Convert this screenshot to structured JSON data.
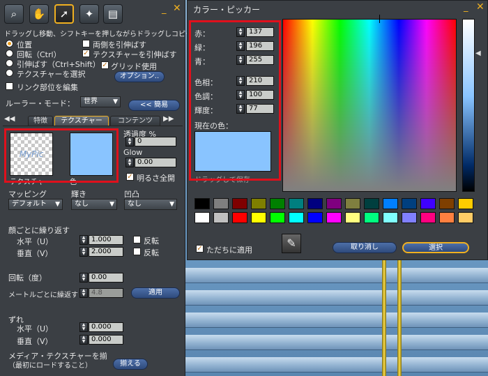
{
  "build": {
    "tool_icons": [
      "zoom-icon",
      "grab-hand-icon",
      "select-arrow-icon",
      "wand-icon",
      "land-icon"
    ],
    "hint": "ドラッグし移動、シフトキーを押しながらドラッグしコピー",
    "options": {
      "position": "位置",
      "rotate": "回転（Ctrl）",
      "stretch": "引伸ばす（Ctrl+Shift）",
      "select_texture": "テクスチャーを選択",
      "stretch_both": "両側を引伸ばす",
      "stretch_texture": "テクスチャーを引伸ばす",
      "grid": "グリッド使用",
      "options_button": "オプション..",
      "edit_linked": "リンク部位を編集"
    },
    "ruler_label": "ルーラー・モード：",
    "ruler_value": "世界",
    "simple_button": "<< 簡易",
    "tabs": [
      "特徴",
      "テクスチャー",
      "コンテンツ"
    ],
    "texture_label": "テクスチャ",
    "texture_preview_text": "MyPic",
    "color_label": "色",
    "transparency_label": "透過度 %",
    "transparency_value": "0",
    "glow_label": "Glow",
    "glow_value": "0.00",
    "full_bright_label": "明るさ全開",
    "mapping_label": "マッピング",
    "mapping_value": "デフォルト",
    "shininess_label": "輝き",
    "shininess_value": "なし",
    "bumpiness_label": "凹凸",
    "bumpiness_value": "なし",
    "repeats_per_face": "顔ごとに繰り返す",
    "horizontal_u": "水平（U）",
    "horizontal_u_value": "1.000",
    "vertical_v": "垂直（V）",
    "vertical_v_value": "2.000",
    "flip": "反転",
    "rotation_label": "回転（度）",
    "rotation_value": "0.00",
    "repeats_per_meter": "メートルごとに繰返す",
    "repeats_per_meter_value": "4.8",
    "apply_button": "適用",
    "offset_label": "ずれ",
    "offset_u": "水平（U）",
    "offset_u_value": "0.000",
    "offset_v": "垂直（V）",
    "offset_v_value": "0.000",
    "media_align": "メディア・テクスチャーを揃",
    "media_align2": "（最初にロードすること）",
    "align_button": "揃える"
  },
  "picker": {
    "title": "カラー・ピッカー",
    "red_label": "赤：",
    "red": "137",
    "green_label": "緑：",
    "green": "196",
    "blue_label": "青：",
    "blue": "255",
    "hue_label": "色相：",
    "hue": "210",
    "sat_label": "色調：",
    "sat": "100",
    "lum_label": "輝度：",
    "lum": "77",
    "current_label": "現在の色：",
    "drag_hint": "ドラッグして保存",
    "current_color": "#89c4ff",
    "apply_now": "ただちに適用",
    "cancel_button": "取り消し",
    "select_button": "選択",
    "swatches_row1": [
      "#000000",
      "#7f7f7f",
      "#7f0000",
      "#7f7f00",
      "#007f00",
      "#007f7f",
      "#00007f",
      "#7f007f",
      "#7f7f3f",
      "#003f3f",
      "#007fff",
      "#003f7f",
      "#3f00ff",
      "#7f3f00",
      "#ffcc00"
    ],
    "swatches_row2": [
      "#ffffff",
      "#c0c0c0",
      "#ff0000",
      "#ffff00",
      "#00ff00",
      "#00ffff",
      "#0000ff",
      "#ff00ff",
      "#ffff80",
      "#00ff80",
      "#80ffff",
      "#8080ff",
      "#ff0080",
      "#ff8040",
      "#ffcc66"
    ]
  }
}
